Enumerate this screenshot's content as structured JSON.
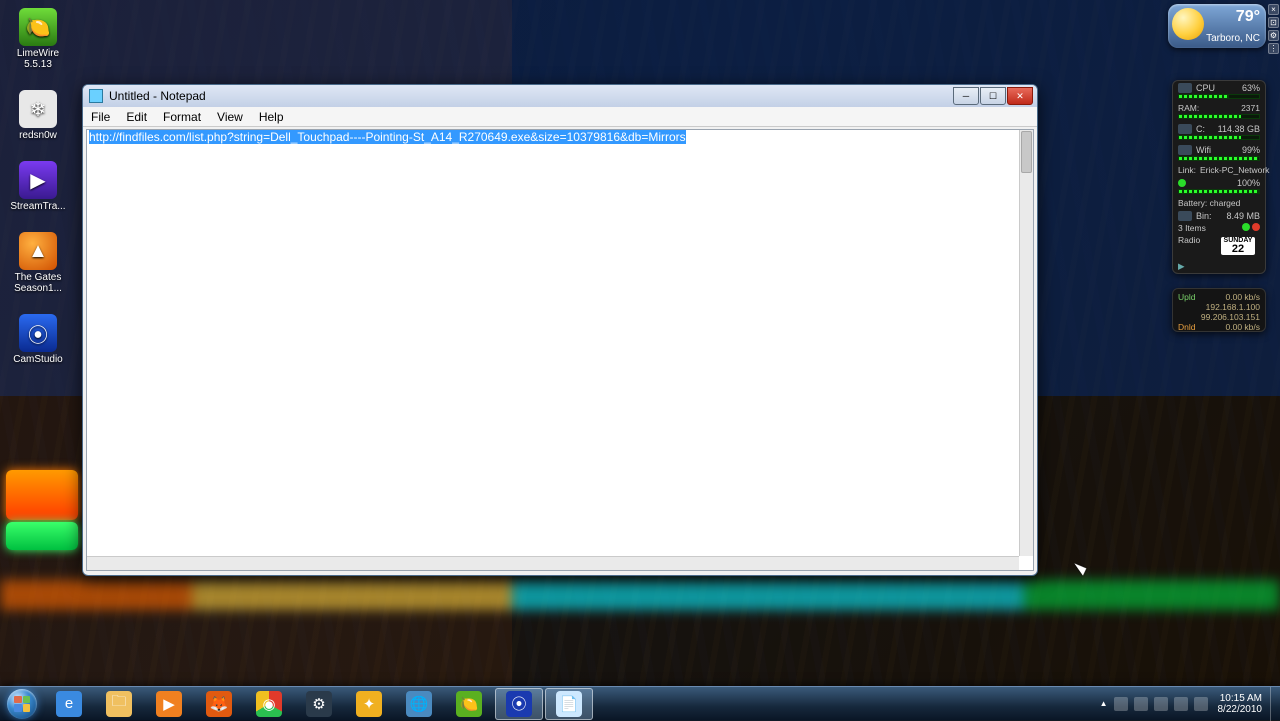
{
  "desktop": {
    "icons": [
      {
        "label": "LimeWire 5.5.13"
      },
      {
        "label": "redsn0w"
      },
      {
        "label": "StreamTra..."
      },
      {
        "label": "The Gates Season1..."
      },
      {
        "label": "CamStudio"
      }
    ]
  },
  "notepad": {
    "title": "Untitled - Notepad",
    "menu": [
      "File",
      "Edit",
      "Format",
      "View",
      "Help"
    ],
    "content": "http://findfiles.com/list.php?string=Dell_Touchpad----Pointing-St_A14_R270649.exe&size=10379816&db=Mirrors"
  },
  "weather": {
    "temp": "79°",
    "location": "Tarboro, NC"
  },
  "sysmon": {
    "cpu": {
      "label": "CPU",
      "value": "63%",
      "pct": 63
    },
    "ram": {
      "label": "RAM:",
      "value": "2371",
      "pct": 77
    },
    "disk": {
      "label": "C:",
      "value": "114.38 GB",
      "pct_free": 77
    },
    "wifi": {
      "label": "Wifi",
      "value": "99%",
      "pct": 99
    },
    "link": {
      "label": "Link:",
      "value": "Erick-PC_Network"
    },
    "bat_pct": "100%",
    "bat_status": "Battery: charged",
    "bin": {
      "label": "Bin:",
      "size": "8.49 MB",
      "items": "3 Items"
    },
    "radio": "Radio",
    "cal_day": "SUNDAY",
    "cal_num": "22"
  },
  "net": {
    "up_label": "Upld",
    "up_val": "0.00 kb/s",
    "local_ip": "192.168.1.100",
    "ext_ip": "99.206.103.151",
    "dn_label": "Dnld",
    "dn_val": "0.00 kb/s"
  },
  "tray": {
    "time": "10:15 AM",
    "date": "8/22/2010",
    "up": "▲"
  }
}
